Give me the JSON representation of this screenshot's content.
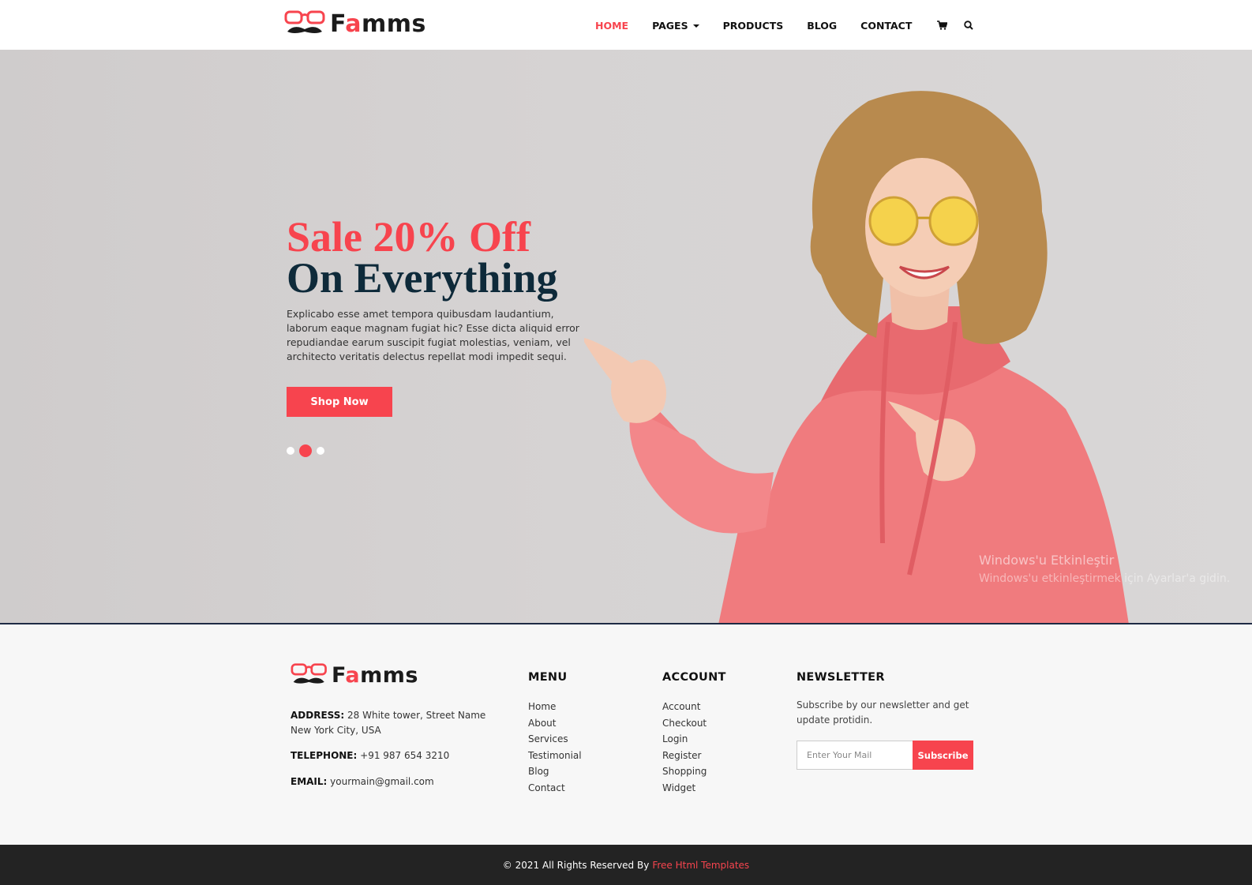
{
  "brand": {
    "name_pre": "F",
    "name_accent": "a",
    "name_post": "mms",
    "accent_color": "#f7444e",
    "dark_color": "#0e2a3a"
  },
  "nav": {
    "items": [
      {
        "label": "HOME",
        "active": true
      },
      {
        "label": "PAGES",
        "dropdown": true
      },
      {
        "label": "PRODUCTS"
      },
      {
        "label": "BLOG"
      },
      {
        "label": "CONTACT"
      }
    ],
    "icons": [
      "cart-icon",
      "search-icon"
    ]
  },
  "hero": {
    "title_line1": "Sale 20% Off",
    "title_line2": "On Everything",
    "description": "Explicabo esse amet tempora quibusdam laudantium, laborum eaque magnam fugiat hic? Esse dicta aliquid error repudiandae earum suscipit fugiat molestias, veniam, vel architecto veritatis delectus repellat modi impedit sequi.",
    "cta_label": "Shop Now",
    "slides": 3,
    "active_slide": 2,
    "watermark_title": "Windows'u Etkinleştir",
    "watermark_sub": "Windows'u etkinleştirmek için Ayarlar'a gidin."
  },
  "footer": {
    "address_label": "ADDRESS:",
    "address_value": "28 White tower, Street Name New York City, USA",
    "phone_label": "TELEPHONE:",
    "phone_value": "+91 987 654 3210",
    "email_label": "EMAIL:",
    "email_value": "yourmain@gmail.com",
    "menu_title": "MENU",
    "menu_items": [
      "Home",
      "About",
      "Services",
      "Testimonial",
      "Blog",
      "Contact"
    ],
    "account_title": "ACCOUNT",
    "account_items": [
      "Account",
      "Checkout",
      "Login",
      "Register",
      "Shopping",
      "Widget"
    ],
    "newsletter_title": "NEWSLETTER",
    "newsletter_desc": "Subscribe by our newsletter and get update protidin.",
    "newsletter_placeholder": "Enter Your Mail",
    "newsletter_button": "Subscribe"
  },
  "copyright": {
    "text": "© 2021 All Rights Reserved By",
    "link": "Free Html Templates"
  }
}
